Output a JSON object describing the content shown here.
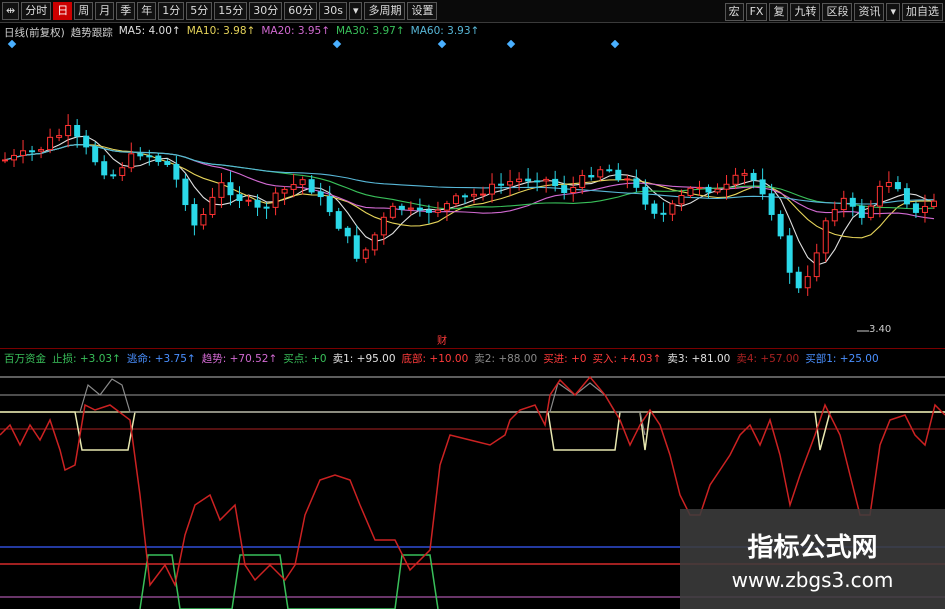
{
  "toolbar": {
    "left_buttons": [
      "⇹",
      "分时",
      "日",
      "周",
      "月",
      "季",
      "年",
      "1分",
      "5分",
      "15分",
      "30分",
      "60分",
      "30s",
      "▾",
      "多周期",
      "设置"
    ],
    "active_index": 2,
    "right_buttons": [
      "宏",
      "FX",
      "复",
      "九转",
      "区段",
      "资讯",
      "▾",
      "加自选"
    ]
  },
  "main_legend": {
    "items": [
      {
        "text": "日线(前复权)",
        "color": "#cfcfcf"
      },
      {
        "text": "趋势跟踪",
        "color": "#cfcfcf"
      },
      {
        "text": "MA5: 4.00↑",
        "color": "#e0e0e0"
      },
      {
        "text": "MA10: 3.98↑",
        "color": "#e6d45a"
      },
      {
        "text": "MA20: 3.95↑",
        "color": "#d26ad2"
      },
      {
        "text": "MA30: 3.97↑",
        "color": "#39c05a"
      },
      {
        "text": "MA60: 3.93↑",
        "color": "#58b8d8"
      }
    ]
  },
  "price_label": "3.40",
  "chart_marker": "财",
  "indicator_legend": {
    "items": [
      {
        "text": "百万资金",
        "color": "#39c05a"
      },
      {
        "text": "止损: +3.03↑",
        "color": "#39c05a"
      },
      {
        "text": "逃命: +3.75↑",
        "color": "#4a90ff"
      },
      {
        "text": "趋势: +70.52↑",
        "color": "#d26ad2"
      },
      {
        "text": "买点: +0",
        "color": "#39c05a"
      },
      {
        "text": "卖1: +95.00",
        "color": "#e0e0e0"
      },
      {
        "text": "底部: +10.00",
        "color": "#ff3b3b"
      },
      {
        "text": "卖2: +88.00",
        "color": "#888888"
      },
      {
        "text": "买进: +0",
        "color": "#ff3b3b"
      },
      {
        "text": "买入: +4.03↑",
        "color": "#ff3b3b"
      },
      {
        "text": "卖3: +81.00",
        "color": "#e0e0e0"
      },
      {
        "text": "卖4: +57.00",
        "color": "#aa2222"
      },
      {
        "text": "买部1: +25.00",
        "color": "#4a90ff"
      }
    ]
  },
  "watermark": {
    "title": "指标公式网",
    "url": "www.zbgs3.com"
  },
  "colors": {
    "up": "#ff3333",
    "down": "#2bd8e8",
    "ma5": "#e0e0e0",
    "ma10": "#e6d45a",
    "ma20": "#d26ad2",
    "ma30": "#39c05a",
    "ma60": "#58b8d8"
  }
}
